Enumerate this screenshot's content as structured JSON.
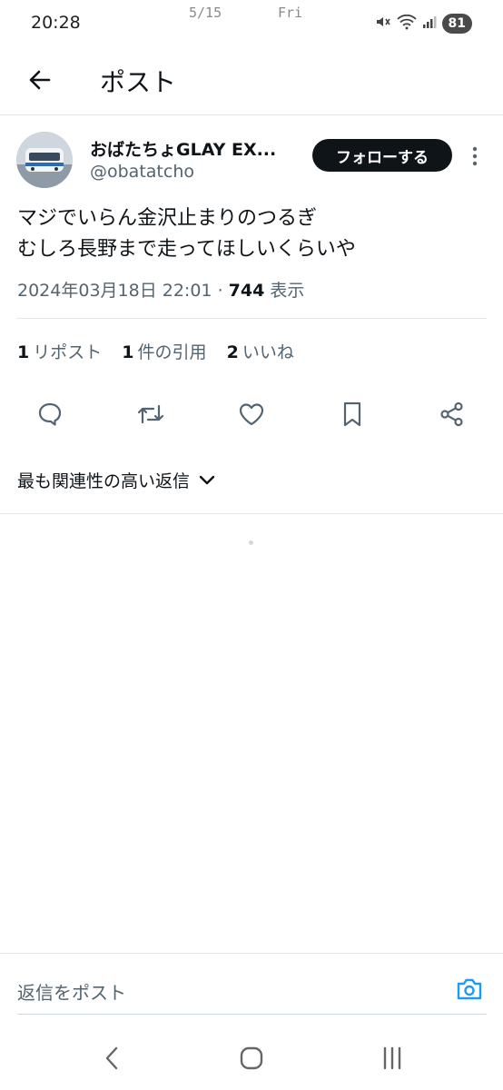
{
  "status_bar": {
    "time": "20:28",
    "date": "5/15",
    "day": "Fri",
    "battery": "81"
  },
  "header": {
    "title": "ポスト"
  },
  "post": {
    "author_name": "おばたちょGLAY EX...",
    "author_handle": "@obatatcho",
    "follow_label": "フォローする",
    "text_lines": [
      "マジでいらん金沢止まりのつるぎ",
      "むしろ長野まで走ってほしいくらいや"
    ],
    "timestamp": "2024年03月18日 22:01",
    "separator": "·",
    "views_count": "744",
    "views_label": "表示"
  },
  "stats": {
    "reposts_count": "1",
    "reposts_label": "リポスト",
    "quotes_count": "1",
    "quotes_label": "件の引用",
    "likes_count": "2",
    "likes_label": "いいね"
  },
  "replies": {
    "sort_label": "最も関連性の高い返信"
  },
  "reply_bar": {
    "placeholder": "返信をポスト"
  },
  "colors": {
    "text_primary": "#0f1419",
    "text_secondary": "#536471",
    "accent": "#1d9bf0",
    "divider": "#e6e9ec",
    "follow_bg": "#0f1419"
  },
  "icons": {
    "back": "arrow-left-icon",
    "more": "more-vertical-icon",
    "reply": "reply-icon",
    "repost": "repost-icon",
    "like": "heart-icon",
    "bookmark": "bookmark-icon",
    "share": "share-icon",
    "sort": "chevron-down-icon",
    "camera": "camera-icon",
    "nav_back": "nav-back-icon",
    "nav_home": "nav-home-icon",
    "nav_recents": "nav-recents-icon"
  }
}
